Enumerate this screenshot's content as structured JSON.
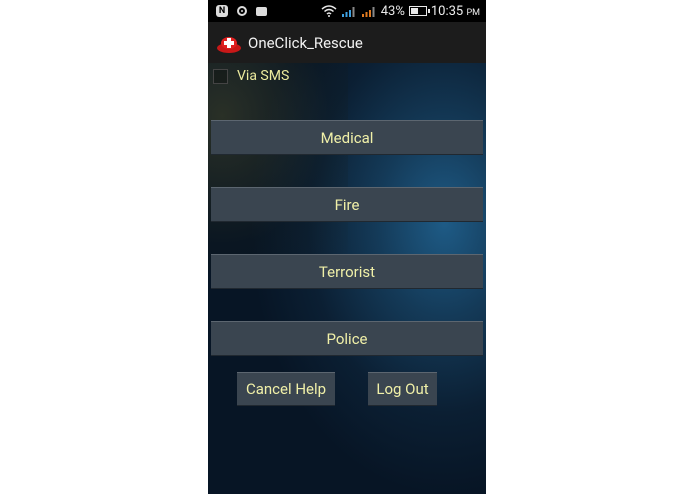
{
  "statusbar": {
    "battery_percent": "43%",
    "time": "10:35",
    "ampm": "PM",
    "icons": [
      "notification-n-icon",
      "circle-notification-icon",
      "camera-notification-icon",
      "wifi-icon",
      "signal-1-icon",
      "signal-2-icon",
      "battery-icon"
    ]
  },
  "app": {
    "title": "OneClick_Rescue",
    "logo_icon": "rescue-logo-icon",
    "accent_color": "#e02020"
  },
  "options": {
    "via_sms_label": "Via SMS",
    "via_sms_checked": false
  },
  "buttons": {
    "medical": "Medical",
    "fire": "Fire",
    "terrorist": "Terrorist",
    "police": "Police",
    "cancel_help": "Cancel Help",
    "log_out": "Log Out"
  }
}
